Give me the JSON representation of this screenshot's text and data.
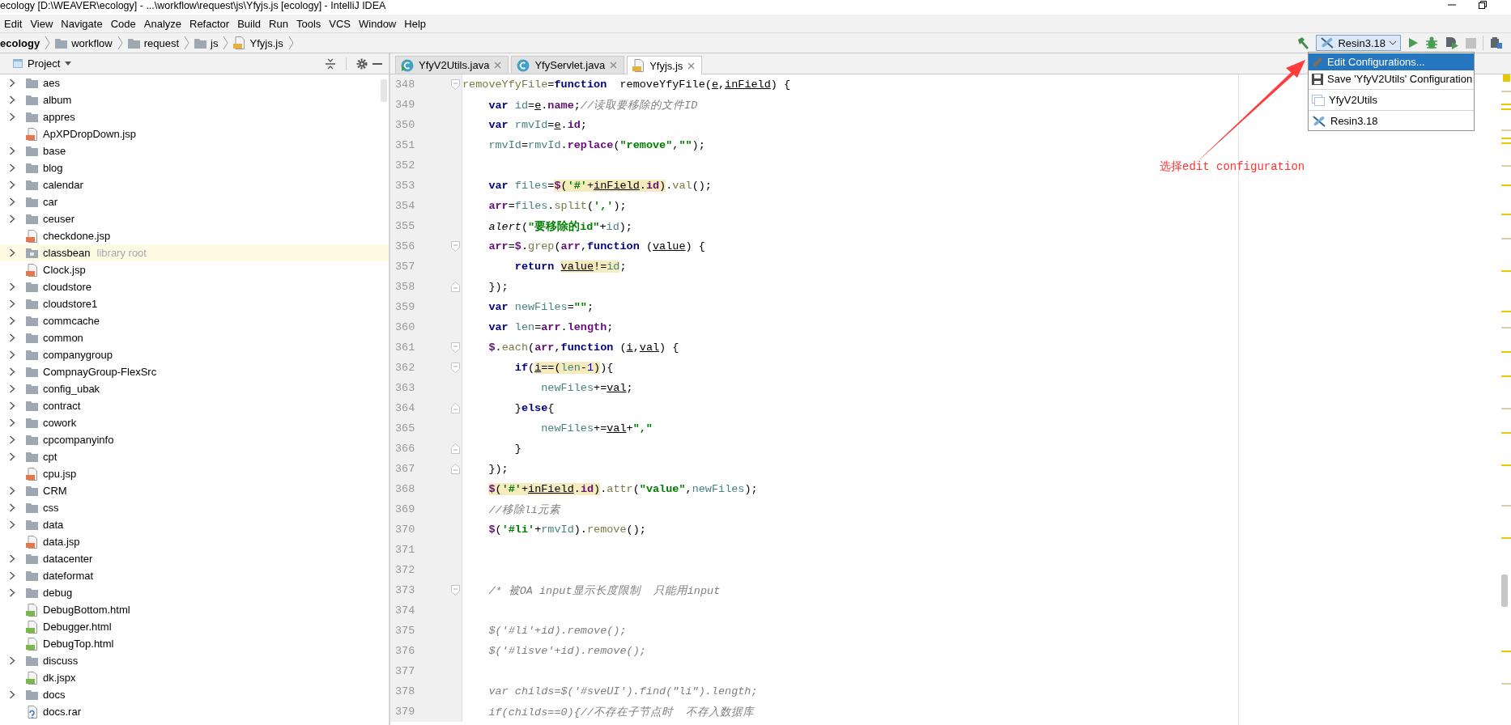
{
  "window": {
    "title": "ecology [D:\\WEAVER\\ecology] - ...\\workflow\\request\\js\\Yfyjs.js [ecology] - IntelliJ IDEA"
  },
  "menu": [
    "Edit",
    "View",
    "Navigate",
    "Code",
    "Analyze",
    "Refactor",
    "Build",
    "Run",
    "Tools",
    "VCS",
    "Window",
    "Help"
  ],
  "breadcrumb": [
    {
      "text": "ecology",
      "kind": "project"
    },
    {
      "text": "workflow",
      "kind": "folder"
    },
    {
      "text": "request",
      "kind": "folder"
    },
    {
      "text": "js",
      "kind": "folder"
    },
    {
      "text": "Yfyjs.js",
      "kind": "js"
    }
  ],
  "toolbar": {
    "run_configuration": "Resin3.18"
  },
  "project_panel": {
    "title": "Project",
    "tree": [
      {
        "name": "aes",
        "kind": "folder"
      },
      {
        "name": "album",
        "kind": "folder"
      },
      {
        "name": "appres",
        "kind": "folder"
      },
      {
        "name": "ApXPDropDown.jsp",
        "kind": "jsp"
      },
      {
        "name": "base",
        "kind": "folder"
      },
      {
        "name": "blog",
        "kind": "folder"
      },
      {
        "name": "calendar",
        "kind": "folder"
      },
      {
        "name": "car",
        "kind": "folder"
      },
      {
        "name": "ceuser",
        "kind": "folder"
      },
      {
        "name": "checkdone.jsp",
        "kind": "jsp"
      },
      {
        "name": "classbean",
        "kind": "library",
        "note": "library root"
      },
      {
        "name": "Clock.jsp",
        "kind": "jsp"
      },
      {
        "name": "cloudstore",
        "kind": "folder"
      },
      {
        "name": "cloudstore1",
        "kind": "folder"
      },
      {
        "name": "commcache",
        "kind": "folder"
      },
      {
        "name": "common",
        "kind": "folder"
      },
      {
        "name": "companygroup",
        "kind": "folder"
      },
      {
        "name": "CompnayGroup-FlexSrc",
        "kind": "folder"
      },
      {
        "name": "config_ubak",
        "kind": "folder"
      },
      {
        "name": "contract",
        "kind": "folder"
      },
      {
        "name": "cowork",
        "kind": "folder"
      },
      {
        "name": "cpcompanyinfo",
        "kind": "folder"
      },
      {
        "name": "cpt",
        "kind": "folder"
      },
      {
        "name": "cpu.jsp",
        "kind": "jsp"
      },
      {
        "name": "CRM",
        "kind": "folder"
      },
      {
        "name": "css",
        "kind": "folder"
      },
      {
        "name": "data",
        "kind": "folder"
      },
      {
        "name": "data.jsp",
        "kind": "jsp"
      },
      {
        "name": "datacenter",
        "kind": "folder"
      },
      {
        "name": "dateformat",
        "kind": "folder"
      },
      {
        "name": "debug",
        "kind": "folder"
      },
      {
        "name": "DebugBottom.html",
        "kind": "html"
      },
      {
        "name": "Debugger.html",
        "kind": "html"
      },
      {
        "name": "DebugTop.html",
        "kind": "html"
      },
      {
        "name": "discuss",
        "kind": "folder"
      },
      {
        "name": "dk.jspx",
        "kind": "jspx"
      },
      {
        "name": "docs",
        "kind": "folder"
      },
      {
        "name": "docs.rar",
        "kind": "unknown"
      }
    ]
  },
  "tabs": [
    {
      "label": "YfyV2Utils.java",
      "kind": "java-runnable",
      "selected": false
    },
    {
      "label": "YfyServlet.java",
      "kind": "java",
      "selected": false
    },
    {
      "label": "Yfyjs.js",
      "kind": "js",
      "selected": true
    }
  ],
  "editor": {
    "lines": [
      {
        "number": "348",
        "fold_start": true,
        "fold_end": false,
        "tokens": [
          {
            "kind": "method",
            "text": "removeYfyFile"
          },
          {
            "kind": "plain",
            "text": "="
          },
          {
            "kind": "keyword",
            "text": "function"
          },
          {
            "kind": "plain",
            "text": "  removeYfyFile("
          },
          {
            "kind": "param",
            "text": "e"
          },
          {
            "kind": "plain",
            "text": ","
          },
          {
            "kind": "param",
            "text": "inField"
          },
          {
            "kind": "plain",
            "text": ") {"
          }
        ]
      },
      {
        "number": "349",
        "fold_start": false,
        "fold_end": false,
        "tokens": [
          {
            "kind": "keyword",
            "text": "    var "
          },
          {
            "kind": "local",
            "text": "id"
          },
          {
            "kind": "plain",
            "text": "="
          },
          {
            "kind": "param",
            "text": "e"
          },
          {
            "kind": "plain",
            "text": "."
          },
          {
            "kind": "member",
            "text": "name"
          },
          {
            "kind": "plain",
            "text": ";"
          },
          {
            "kind": "comment",
            "text": "//读取要移除的文件ID"
          }
        ]
      },
      {
        "number": "350",
        "fold_start": false,
        "fold_end": false,
        "tokens": [
          {
            "kind": "keyword",
            "text": "    var "
          },
          {
            "kind": "local",
            "text": "rmvId"
          },
          {
            "kind": "plain",
            "text": "="
          },
          {
            "kind": "param",
            "text": "e"
          },
          {
            "kind": "plain",
            "text": "."
          },
          {
            "kind": "member",
            "text": "id"
          },
          {
            "kind": "plain",
            "text": ";"
          }
        ]
      },
      {
        "number": "351",
        "fold_start": false,
        "fold_end": false,
        "tokens": [
          {
            "kind": "local",
            "text": "    rmvId"
          },
          {
            "kind": "plain",
            "text": "="
          },
          {
            "kind": "local",
            "text": "rmvId"
          },
          {
            "kind": "plain",
            "text": "."
          },
          {
            "kind": "member",
            "text": "replace"
          },
          {
            "kind": "plain",
            "text": "("
          },
          {
            "kind": "string",
            "text": "\"remove\""
          },
          {
            "kind": "plain",
            "text": ","
          },
          {
            "kind": "string",
            "text": "\"\""
          },
          {
            "kind": "plain",
            "text": ");"
          }
        ]
      },
      {
        "number": "352",
        "fold_start": false,
        "fold_end": false
      },
      {
        "number": "353",
        "fold_start": false,
        "fold_end": false,
        "tokens": [
          {
            "kind": "keyword",
            "text": "    var "
          },
          {
            "kind": "local",
            "text": "files"
          },
          {
            "kind": "plain",
            "text": "="
          },
          {
            "kind": "highlight",
            "children": [
              {
                "kind": "global",
                "text": "$"
              },
              {
                "kind": "plain",
                "text": "("
              },
              {
                "kind": "string",
                "text": "'#'"
              },
              {
                "kind": "plain",
                "text": "+"
              },
              {
                "kind": "param",
                "text": "inField"
              },
              {
                "kind": "plain",
                "text": "."
              },
              {
                "kind": "member",
                "text": "id"
              },
              {
                "kind": "plain",
                "text": ")"
              }
            ]
          },
          {
            "kind": "plain",
            "text": "."
          },
          {
            "kind": "method",
            "text": "val"
          },
          {
            "kind": "plain",
            "text": "();"
          }
        ]
      },
      {
        "number": "354",
        "fold_start": false,
        "fold_end": false,
        "tokens": [
          {
            "kind": "global",
            "text": "    arr"
          },
          {
            "kind": "plain",
            "text": "="
          },
          {
            "kind": "local",
            "text": "files"
          },
          {
            "kind": "plain",
            "text": "."
          },
          {
            "kind": "method",
            "text": "split"
          },
          {
            "kind": "plain",
            "text": "("
          },
          {
            "kind": "string",
            "text": "','"
          },
          {
            "kind": "plain",
            "text": ");"
          }
        ]
      },
      {
        "number": "355",
        "fold_start": false,
        "fold_end": false,
        "tokens": [
          {
            "kind": "call",
            "text": "    alert"
          },
          {
            "kind": "plain",
            "text": "("
          },
          {
            "kind": "string",
            "text": "\"要移除的id\""
          },
          {
            "kind": "plain",
            "text": "+"
          },
          {
            "kind": "local",
            "text": "id"
          },
          {
            "kind": "plain",
            "text": ");"
          }
        ]
      },
      {
        "number": "356",
        "fold_start": true,
        "fold_end": false,
        "tokens": [
          {
            "kind": "global",
            "text": "    arr"
          },
          {
            "kind": "plain",
            "text": "="
          },
          {
            "kind": "global",
            "text": "$"
          },
          {
            "kind": "plain",
            "text": "."
          },
          {
            "kind": "method",
            "text": "grep"
          },
          {
            "kind": "plain",
            "text": "("
          },
          {
            "kind": "global",
            "text": "arr"
          },
          {
            "kind": "plain",
            "text": ","
          },
          {
            "kind": "keyword",
            "text": "function"
          },
          {
            "kind": "plain",
            "text": " ("
          },
          {
            "kind": "param",
            "text": "value"
          },
          {
            "kind": "plain",
            "text": ") {"
          }
        ]
      },
      {
        "number": "357",
        "fold_start": false,
        "fold_end": false,
        "tokens": [
          {
            "kind": "keyword",
            "text": "        return "
          },
          {
            "kind": "highlight",
            "children": [
              {
                "kind": "param",
                "text": "value"
              },
              {
                "kind": "plain",
                "text": "!="
              },
              {
                "kind": "local",
                "text": "id"
              }
            ]
          },
          {
            "kind": "plain",
            "text": ";"
          }
        ]
      },
      {
        "number": "358",
        "fold_start": false,
        "fold_end": true,
        "tokens": [
          {
            "kind": "plain",
            "text": "    });"
          }
        ]
      },
      {
        "number": "359",
        "fold_start": false,
        "fold_end": false,
        "tokens": [
          {
            "kind": "keyword",
            "text": "    var "
          },
          {
            "kind": "local",
            "text": "newFiles"
          },
          {
            "kind": "plain",
            "text": "="
          },
          {
            "kind": "string",
            "text": "\"\""
          },
          {
            "kind": "plain",
            "text": ";"
          }
        ]
      },
      {
        "number": "360",
        "fold_start": false,
        "fold_end": false,
        "tokens": [
          {
            "kind": "keyword",
            "text": "    var "
          },
          {
            "kind": "local",
            "text": "len"
          },
          {
            "kind": "plain",
            "text": "="
          },
          {
            "kind": "global",
            "text": "arr"
          },
          {
            "kind": "plain",
            "text": "."
          },
          {
            "kind": "member",
            "text": "length"
          },
          {
            "kind": "plain",
            "text": ";"
          }
        ]
      },
      {
        "number": "361",
        "fold_start": true,
        "fold_end": false,
        "tokens": [
          {
            "kind": "global",
            "text": "    $"
          },
          {
            "kind": "plain",
            "text": "."
          },
          {
            "kind": "method",
            "text": "each"
          },
          {
            "kind": "plain",
            "text": "("
          },
          {
            "kind": "global",
            "text": "arr"
          },
          {
            "kind": "plain",
            "text": ","
          },
          {
            "kind": "keyword",
            "text": "function"
          },
          {
            "kind": "plain",
            "text": " ("
          },
          {
            "kind": "param",
            "text": "i"
          },
          {
            "kind": "plain",
            "text": ","
          },
          {
            "kind": "param",
            "text": "val"
          },
          {
            "kind": "plain",
            "text": ") {"
          }
        ]
      },
      {
        "number": "362",
        "fold_start": true,
        "fold_end": false,
        "tokens": [
          {
            "kind": "keyword",
            "text": "        if"
          },
          {
            "kind": "plain",
            "text": "("
          },
          {
            "kind": "highlight",
            "children": [
              {
                "kind": "param",
                "text": "i"
              },
              {
                "kind": "plain",
                "text": "==("
              },
              {
                "kind": "local",
                "text": "len"
              },
              {
                "kind": "plain",
                "text": "-"
              },
              {
                "kind": "number",
                "text": "1"
              },
              {
                "kind": "plain",
                "text": ")"
              }
            ]
          },
          {
            "kind": "plain",
            "text": "){"
          }
        ]
      },
      {
        "number": "363",
        "fold_start": false,
        "fold_end": false,
        "tokens": [
          {
            "kind": "local",
            "text": "            newFiles"
          },
          {
            "kind": "plain",
            "text": "+="
          },
          {
            "kind": "param",
            "text": "val"
          },
          {
            "kind": "plain",
            "text": ";"
          }
        ]
      },
      {
        "number": "364",
        "fold_start": false,
        "fold_end": true,
        "tokens": [
          {
            "kind": "plain",
            "text": "        }"
          },
          {
            "kind": "keyword",
            "text": "else"
          },
          {
            "kind": "plain",
            "text": "{"
          }
        ]
      },
      {
        "number": "365",
        "fold_start": false,
        "fold_end": false,
        "tokens": [
          {
            "kind": "local",
            "text": "            newFiles"
          },
          {
            "kind": "plain",
            "text": "+="
          },
          {
            "kind": "param",
            "text": "val"
          },
          {
            "kind": "plain",
            "text": "+"
          },
          {
            "kind": "string",
            "text": "\",\""
          }
        ]
      },
      {
        "number": "366",
        "fold_start": false,
        "fold_end": true,
        "tokens": [
          {
            "kind": "plain",
            "text": "        }"
          }
        ]
      },
      {
        "number": "367",
        "fold_start": false,
        "fold_end": true,
        "tokens": [
          {
            "kind": "plain",
            "text": "    });"
          }
        ]
      },
      {
        "number": "368",
        "fold_start": false,
        "fold_end": false,
        "tokens": [
          {
            "kind": "highlight",
            "children": [
              {
                "kind": "global",
                "text": "    $"
              },
              {
                "kind": "plain",
                "text": "("
              },
              {
                "kind": "string",
                "text": "'#'"
              },
              {
                "kind": "plain",
                "text": "+"
              },
              {
                "kind": "param",
                "text": "inField"
              },
              {
                "kind": "plain",
                "text": "."
              },
              {
                "kind": "member",
                "text": "id"
              },
              {
                "kind": "plain",
                "text": ")"
              }
            ]
          },
          {
            "kind": "plain",
            "text": "."
          },
          {
            "kind": "method",
            "text": "attr"
          },
          {
            "kind": "plain",
            "text": "("
          },
          {
            "kind": "string",
            "text": "\"value\""
          },
          {
            "kind": "plain",
            "text": ","
          },
          {
            "kind": "local",
            "text": "newFiles"
          },
          {
            "kind": "plain",
            "text": ");"
          }
        ]
      },
      {
        "number": "369",
        "fold_start": false,
        "fold_end": false,
        "tokens": [
          {
            "kind": "comment",
            "text": "    //移除li元素"
          }
        ]
      },
      {
        "number": "370",
        "fold_start": false,
        "fold_end": false,
        "tokens": [
          {
            "kind": "global",
            "text": "    $"
          },
          {
            "kind": "plain",
            "text": "("
          },
          {
            "kind": "string",
            "text": "'#li'"
          },
          {
            "kind": "plain",
            "text": "+"
          },
          {
            "kind": "local",
            "text": "rmvId"
          },
          {
            "kind": "plain",
            "text": ")."
          },
          {
            "kind": "method",
            "text": "remove"
          },
          {
            "kind": "plain",
            "text": "();"
          }
        ]
      },
      {
        "number": "371",
        "fold_start": false,
        "fold_end": false
      },
      {
        "number": "372",
        "fold_start": false,
        "fold_end": false
      },
      {
        "number": "373",
        "fold_start": true,
        "fold_end": false,
        "tokens": [
          {
            "kind": "comment",
            "text": "    /* 被OA input显示长度限制  只能用input"
          }
        ]
      },
      {
        "number": "374",
        "fold_start": false,
        "fold_end": false
      },
      {
        "number": "375",
        "fold_start": false,
        "fold_end": false,
        "tokens": [
          {
            "kind": "comment",
            "text": "    $('#li'+id).remove();"
          }
        ]
      },
      {
        "number": "376",
        "fold_start": false,
        "fold_end": false,
        "tokens": [
          {
            "kind": "comment",
            "text": "    $('#lisve'+id).remove();"
          }
        ]
      },
      {
        "number": "377",
        "fold_start": false,
        "fold_end": false
      },
      {
        "number": "378",
        "fold_start": false,
        "fold_end": false,
        "tokens": [
          {
            "kind": "comment",
            "text": "    var childs=$('#sveUI').find(\"li\").length;"
          }
        ]
      },
      {
        "number": "379",
        "fold_start": false,
        "fold_end": false,
        "tokens": [
          {
            "kind": "comment",
            "text": "    if(childs==0){//不存在子节点时  不存入数据库"
          }
        ]
      }
    ]
  },
  "popup": {
    "groups": [
      {
        "items": [
          {
            "label": "Edit Configurations...",
            "kind": "edit",
            "selected": true
          },
          {
            "label": "Save 'YfyV2Utils' Configuration",
            "kind": "save",
            "selected": false
          }
        ]
      },
      {
        "items": [
          {
            "label": "YfyV2Utils",
            "kind": "app",
            "selected": false
          }
        ]
      },
      {
        "items": [
          {
            "label": "Resin3.18",
            "kind": "server",
            "selected": false
          }
        ]
      }
    ]
  },
  "annotation": {
    "text": "选择edit configuration"
  }
}
